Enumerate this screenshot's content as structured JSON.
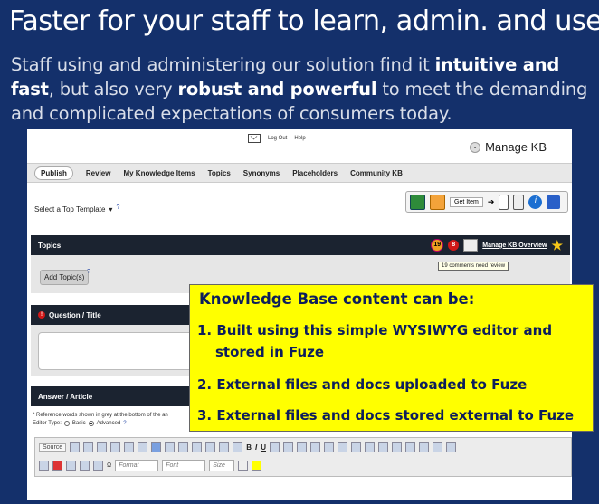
{
  "slide": {
    "title": "Faster for your staff to learn, admin. and use:",
    "subtitle_1": "Staff using and administering our solution find it ",
    "subtitle_bold_1": "intuitive and fast",
    "subtitle_2": ", but also very ",
    "subtitle_bold_2": "robust and powerful",
    "subtitle_3": " to meet the demanding and complicated expectations of consumers today."
  },
  "app": {
    "top_links": [
      "Log Out",
      "Help"
    ],
    "manage_kb": "Manage KB",
    "nav_tabs": [
      "Publish",
      "Review",
      "My Knowledge Items",
      "Topics",
      "Synonyms",
      "Placeholders",
      "Community KB"
    ],
    "template_select": "Select a Top Template",
    "help_mark": "?",
    "get_item_label": "Get Item",
    "topics_title": "Topics",
    "comments_badge": "19",
    "alerts_badge": "8",
    "manage_kb_overview": "Manage KB Overview",
    "tooltip": "19 comments need review",
    "add_topic_button": "Add Topic(s)",
    "question_title": "Question / Title",
    "answer_title": "Answer / Article",
    "reference_note": "* Reference words shown in grey at the bottom of the an",
    "editor_type_label": "Editor Type:",
    "editor_basic": "Basic",
    "editor_advanced": "Advanced",
    "toolbar": {
      "source": "Source",
      "format": "Format",
      "font": "Font",
      "size": "Size",
      "bold": "B",
      "italic": "I",
      "underline": "U"
    }
  },
  "callout": {
    "heading": "Knowledge Base content can be:",
    "items": [
      "1. Built using this simple WYSIWYG editor and",
      "stored in Fuze",
      "2. External files and docs uploaded to Fuze",
      "3. External files and docs stored external to Fuze"
    ]
  }
}
